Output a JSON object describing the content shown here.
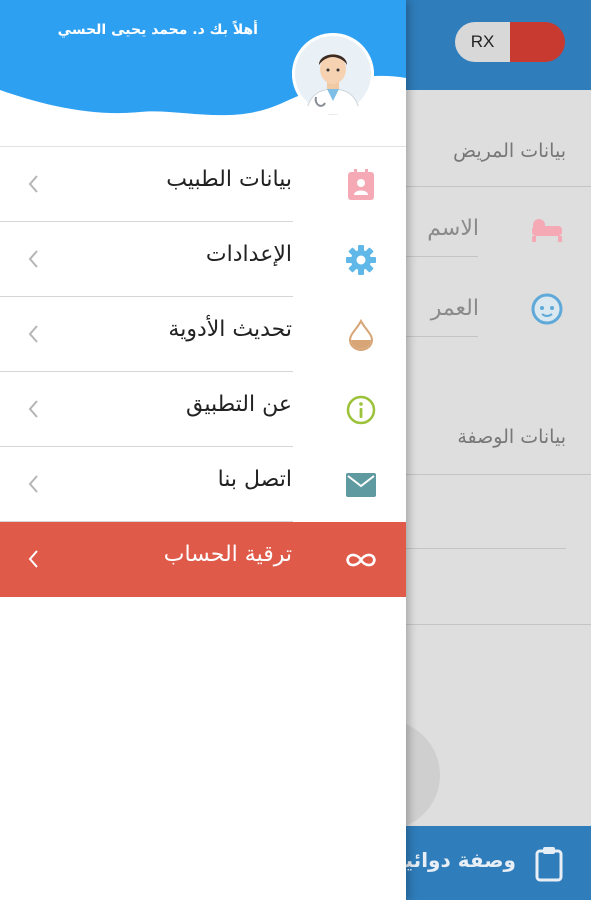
{
  "background": {
    "rx_label": "RX",
    "patient_section": "بيانات المريض",
    "name_field": "الاسم",
    "age_field": "العمر",
    "prescription_section": "بيانات الوصفة",
    "bottom_button": "وصفة دوائية"
  },
  "drawer": {
    "greeting": "أهلاً بك د. محمد يحيى الحسي",
    "items": [
      {
        "label": "بيانات الطبيب",
        "icon": "doctor-id-icon"
      },
      {
        "label": "الإعدادات",
        "icon": "gear-icon"
      },
      {
        "label": "تحديث الأدوية",
        "icon": "drop-icon"
      },
      {
        "label": "عن التطبيق",
        "icon": "info-icon"
      },
      {
        "label": "اتصل بنا",
        "icon": "mail-icon"
      },
      {
        "label": "ترقية الحساب",
        "icon": "infinity-icon"
      }
    ]
  },
  "colors": {
    "header_blue": "#2f7dbb",
    "drawer_blue": "#2ea0f2",
    "upgrade_red": "#e05a4a",
    "rx_red": "#c8392f"
  }
}
